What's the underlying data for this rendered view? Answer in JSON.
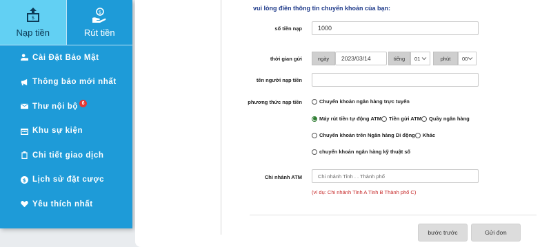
{
  "sidebar": {
    "tabs": [
      {
        "label": "Nạp tiền",
        "icon": "deposit-icon",
        "active": true
      },
      {
        "label": "Rút tiền",
        "icon": "withdraw-icon",
        "active": false
      }
    ],
    "menu": [
      {
        "label": "Cài Đặt Bảo Mật",
        "icon": "user-lock-icon"
      },
      {
        "label": "Thông báo mới nhất",
        "icon": "megaphone-icon"
      },
      {
        "label": "Thư nội bộ",
        "icon": "envelope-icon",
        "badge": "6"
      },
      {
        "label": "Khu sự kiện",
        "icon": "calendar-icon"
      },
      {
        "label": "Chi tiết giao dịch",
        "icon": "clipboard-icon"
      },
      {
        "label": "Lịch sử đặt cược",
        "icon": "dollar-circle-icon"
      },
      {
        "label": "Yêu thích nhất",
        "icon": "heart-icon"
      }
    ]
  },
  "form": {
    "title": "vui lòng điền thông tin chuyển khoản của bạn:",
    "amount": {
      "label": "số tiền nạp",
      "value": "1000"
    },
    "time": {
      "label": "thời gian gửi",
      "date_addon": "ngày",
      "date_value": "2023/03/14",
      "hour_addon": "tiếng",
      "hour_value": "01",
      "minute_addon": "phút",
      "minute_value": "00"
    },
    "sender": {
      "label": "tên người nạp tiền",
      "value": ""
    },
    "method": {
      "label": "phương thức nạp tiền",
      "options": [
        {
          "label": "Chuyển khoản ngân hàng trực tuyến",
          "checked": false
        },
        {
          "label": "Máy rút tiền tự động ATM",
          "checked": true
        },
        {
          "label": "Tiền gửi ATM",
          "checked": false
        },
        {
          "label": "Quầy ngân hàng",
          "checked": false
        },
        {
          "label": "Chuyển khoản trên Ngân hàng Di động",
          "checked": false
        },
        {
          "label": "Khác",
          "checked": false
        },
        {
          "label": "chuyển khoản ngân hàng kỹ thuật số",
          "checked": false
        }
      ]
    },
    "branch": {
      "label": "Chi nhánh ATM",
      "placeholder": "Chi nhánh Tỉnh .            . Thành phố",
      "hint": "(ví dụ: Chi nhánh Tỉnh A Tỉnh B Thành phố C)"
    },
    "buttons": {
      "back": "bước trước",
      "submit": "Gửi đơn"
    }
  },
  "colors": {
    "sidebar_bg": "#1e9bd8",
    "active_tab_bg": "#62d0f3",
    "title_color": "#1e3a8a",
    "hint_color": "#c62828",
    "radio_checked": "#2e7d32",
    "badge_bg": "#e53935"
  }
}
